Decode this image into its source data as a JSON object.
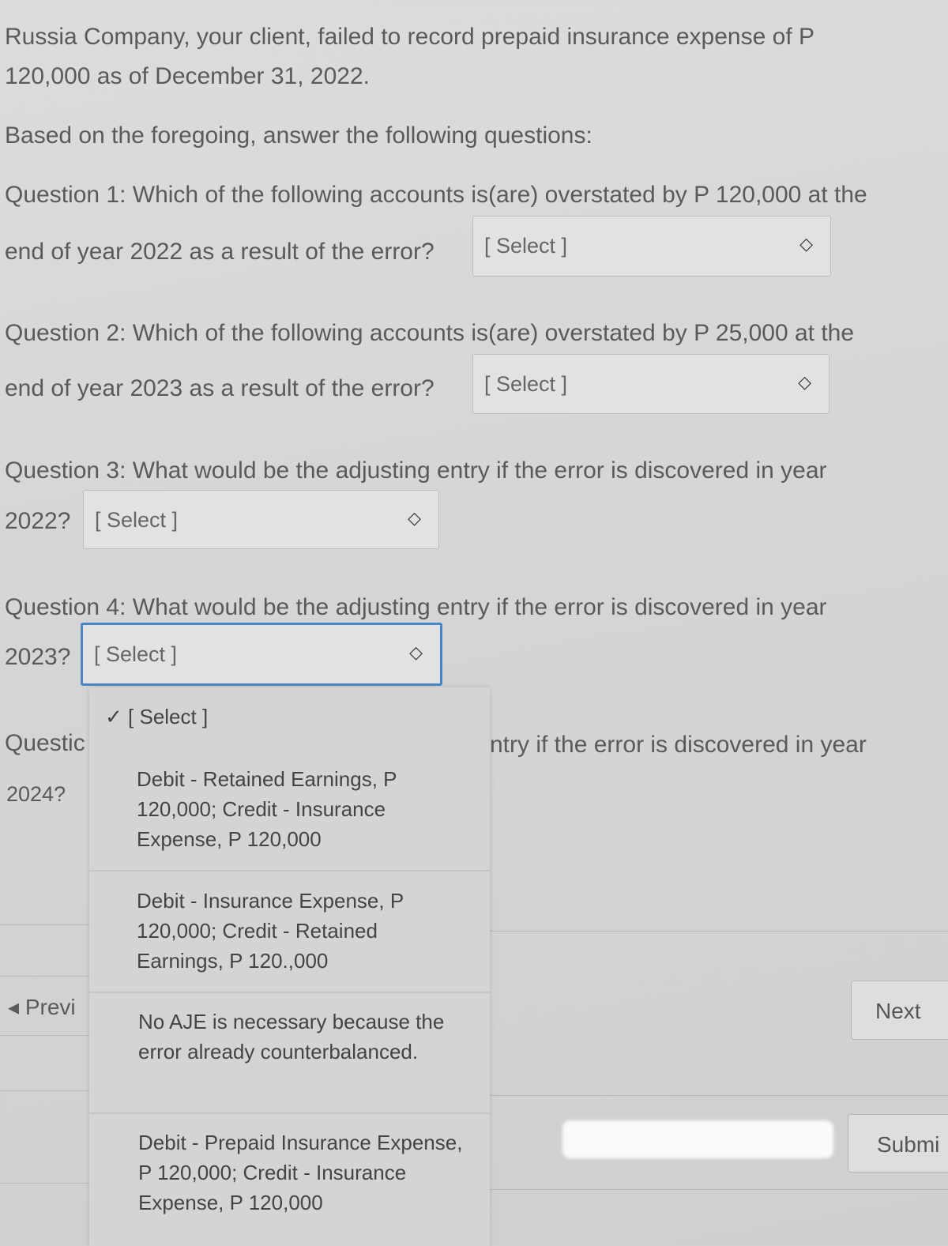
{
  "intro": {
    "line1": "Russia Company, your client, failed to record prepaid insurance expense of P",
    "line2": "120,000 as of December 31, 2022.",
    "prompt": "Based on the foregoing, answer the following questions:"
  },
  "questions": [
    {
      "line1": "Question 1: Which of the following accounts is(are) overstated by P 120,000 at the",
      "line2": "end of year 2022 as a result of the error?",
      "selected": "[ Select ]"
    },
    {
      "line1": "Question 2: Which of the following accounts is(are) overstated by P 25,000 at the",
      "line2": "end of year 2023 as a result of the error?",
      "selected": "[ Select ]"
    },
    {
      "line1": "Question 3: What would be the adjusting entry if the error is discovered in year",
      "line2": "2022?",
      "selected": "[ Select ]"
    },
    {
      "line1": "Question 4: What would be the adjusting entry if the error is discovered in year",
      "line2": "2023?",
      "selected": "[ Select ]"
    },
    {
      "line1_left": "Questic",
      "line1_right": "ntry if the error is discovered in year",
      "line2": "2024?"
    }
  ],
  "dropdown": {
    "check_icon": "✓",
    "options": [
      "[ Select ]",
      "Debit - Retained Earnings, P 120,000; Credit - Insurance Expense, P 120,000",
      "Debit - Insurance Expense, P 120,000; Credit - Retained Earnings, P 120.,000",
      "No AJE is necessary because the error already counterbalanced.",
      "Debit - Prepaid Insurance Expense, P 120,000; Credit - Insurance Expense, P 120,000"
    ]
  },
  "nav": {
    "previous": "◂ Previ",
    "next": "Next",
    "submit": "Submi"
  },
  "colors": {
    "focus": "#4a86c5"
  }
}
